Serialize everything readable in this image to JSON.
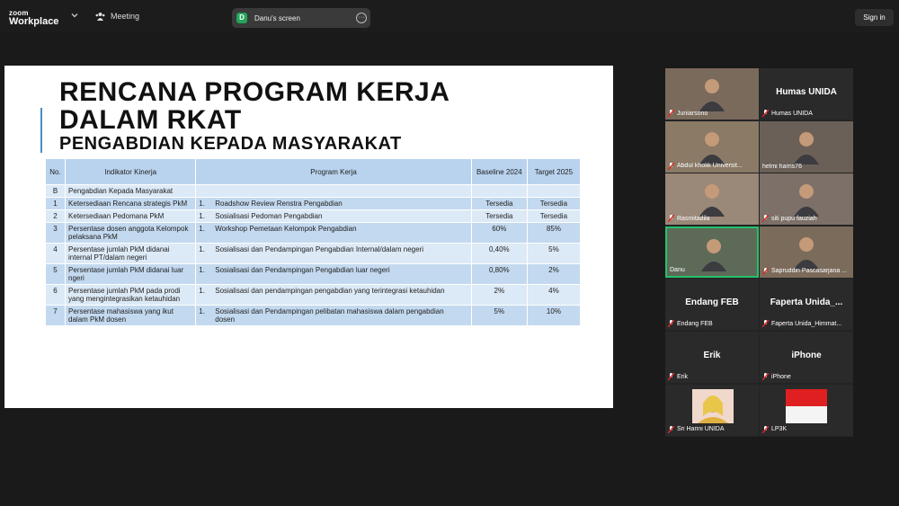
{
  "topbar": {
    "logo_line1": "zoom",
    "logo_line2": "Workplace",
    "meeting_label": "Meeting",
    "screen_badge": "D",
    "screen_label": "Danu's screen",
    "more_label": "···",
    "signin_label": "Sign in"
  },
  "slide": {
    "title_line1": "RENCANA PROGRAM KERJA",
    "title_line2": "DALAM RKAT",
    "subtitle": "PENGABDIAN KEPADA MASYARAKAT",
    "headers": {
      "no": "No.",
      "indikator": "Indikator Kinerja",
      "program": "Program Kerja",
      "baseline": "Baseline 2024",
      "target": "Target 2025"
    },
    "rows": [
      {
        "no": "B",
        "indikator": "Pengabdian Kepada Masyarakat",
        "pnum": "",
        "program": "",
        "baseline": "",
        "target": ""
      },
      {
        "no": "1",
        "indikator": "Ketersediaan Rencana strategis PkM",
        "pnum": "1.",
        "program": "Roadshow Review Renstra Pengabdian",
        "baseline": "Tersedia",
        "target": "Tersedia"
      },
      {
        "no": "2",
        "indikator": "Ketersediaan Pedomana PkM",
        "pnum": "1.",
        "program": "Sosialisasi Pedoman Pengabdian",
        "baseline": "Tersedia",
        "target": "Tersedia"
      },
      {
        "no": "3",
        "indikator": "Persentase dosen anggota Kelompok pelaksana PkM",
        "pnum": "1.",
        "program": "Workshop Pemetaan Kelompok Pengabdian",
        "baseline": "60%",
        "target": "85%"
      },
      {
        "no": "4",
        "indikator": "Persentase jumlah PkM didanai internal PT/dalam negeri",
        "pnum": "1.",
        "program": "Sosialisasi dan Pendampingan Pengabdian Internal/dalam negeri",
        "baseline": "0,40%",
        "target": "5%"
      },
      {
        "no": "5",
        "indikator": "Persentase jumlah PkM didanai luar ngeri",
        "pnum": "1.",
        "program": "Sosialisasi dan Pendampingan Pengabdian luar negeri",
        "baseline": "0,80%",
        "target": "2%"
      },
      {
        "no": "6",
        "indikator": "Persentase jumlah PkM pada prodi yang mengintegrasikan ketauhidan",
        "pnum": "1.",
        "program": "Sosialisasi dan pendampingan pengabdian yang terintegrasi ketauhidan",
        "baseline": "2%",
        "target": "4%"
      },
      {
        "no": "7",
        "indikator": "Persentase mahasiswa yang ikut dalam PkM dosen",
        "pnum": "1.",
        "program": "Sosialisasi dan Pendampingan pelibatan mahasiswa dalam pengabdian dosen",
        "baseline": "5%",
        "target": "10%"
      }
    ]
  },
  "participants": [
    {
      "name": "Juniarsono",
      "big": "",
      "video": true,
      "muted": true
    },
    {
      "name": "Humas UNIDA",
      "big": "Humas UNIDA",
      "video": false,
      "muted": true
    },
    {
      "name": "Abdul kholik Universit...",
      "big": "",
      "video": true,
      "muted": true
    },
    {
      "name": "helmi harris76",
      "big": "",
      "video": true,
      "muted": false
    },
    {
      "name": "Rasmitadila",
      "big": "",
      "video": true,
      "muted": true
    },
    {
      "name": "siti pupu fauziah",
      "big": "",
      "video": true,
      "muted": true
    },
    {
      "name": "Danu",
      "big": "",
      "video": true,
      "muted": false,
      "active": true
    },
    {
      "name": "Sapruddin Pascasarjana ...",
      "big": "",
      "video": true,
      "muted": true
    },
    {
      "name": "Endang FEB",
      "big": "Endang FEB",
      "video": false,
      "muted": true
    },
    {
      "name": "Faperta Unida_Himmat...",
      "big": "Faperta Unida_...",
      "video": false,
      "muted": true
    },
    {
      "name": "Erik",
      "big": "Erik",
      "video": false,
      "muted": true
    },
    {
      "name": "iPhone",
      "big": "iPhone",
      "video": false,
      "muted": true
    },
    {
      "name": "Sri Harini UNIDA",
      "big": "",
      "video": false,
      "muted": true
    },
    {
      "name": "LP3K",
      "big": "",
      "video": false,
      "muted": true
    }
  ],
  "colors": {
    "accent_green": "#23c16b",
    "mute_red": "#e02828",
    "table_header": "#b9d3ee",
    "table_row_a": "#dce9f6",
    "table_row_b": "#c3d9ef"
  }
}
